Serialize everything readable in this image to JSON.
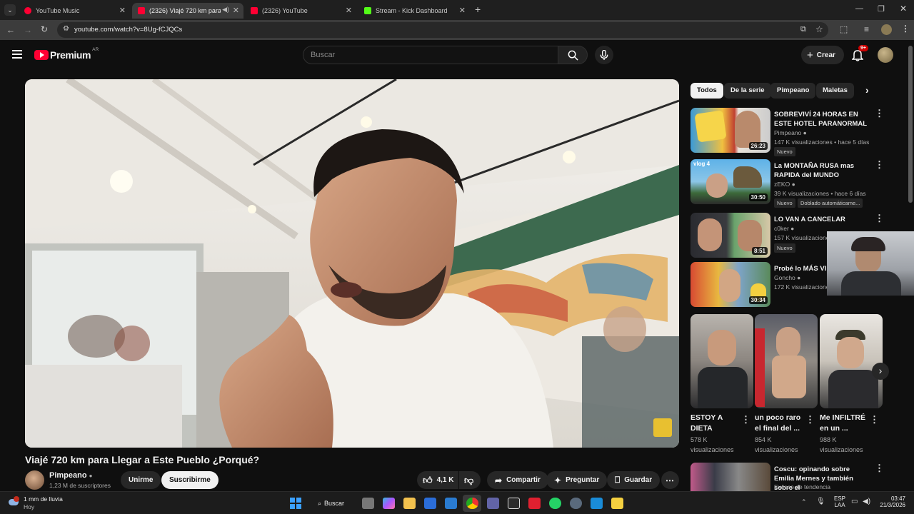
{
  "browser": {
    "tabs": [
      {
        "title": "YouTube Music",
        "active": false
      },
      {
        "title": "(2326) Viajé 720 km para Ll",
        "active": true
      },
      {
        "title": "(2326) YouTube",
        "active": false
      },
      {
        "title": "Stream - Kick Dashboard",
        "active": false
      }
    ],
    "url": "youtube.com/watch?v=8Ug-fCJQCs"
  },
  "header": {
    "logo_text": "Premium",
    "region": "AR",
    "search_placeholder": "Buscar",
    "create_label": "Crear",
    "notif_count": "9+"
  },
  "video": {
    "title": "Viajé 720 km para Llegar a Este Pueblo ¿Porqué?",
    "channel": "Pimpeano",
    "subscribers": "1,23 M de suscriptores",
    "join_label": "Unirme",
    "subscribe_label": "Suscribirme",
    "likes": "4,1 K",
    "share_label": "Compartir",
    "ask_label": "Preguntar",
    "save_label": "Guardar"
  },
  "chips": [
    "Todos",
    "De la serie",
    "Pimpeano",
    "Maletas"
  ],
  "recommendations": [
    {
      "title": "SOBREVIVÍ 24 HORAS EN ESTE HOTEL PARANORMAL",
      "channel": "Pimpeano",
      "meta": "147 K visualizaciones • hace 5 días",
      "badge": "Nuevo",
      "duration": "26:23"
    },
    {
      "title": "La MONTAÑA RUSA mas RAPIDA del MUNDO",
      "channel": "zEKO",
      "meta": "39 K visualizaciones • hace 6 días",
      "badge": "Nuevo",
      "extra": "Doblado automáticame...",
      "duration": "30:50"
    },
    {
      "title": "LO VAN A CANCELAR",
      "channel": "c0ker",
      "meta": "157 K visualizacione",
      "badge": "Nuevo",
      "duration": "8:51"
    },
    {
      "title": "Probé lo MÁS VIR",
      "channel": "Goncho",
      "meta": "172 K visualizacione",
      "duration": "30:34"
    }
  ],
  "shorts": [
    {
      "title": "ESTOY A DIETA",
      "views": "578 K visualizaciones"
    },
    {
      "title": "un poco raro el final del ...",
      "views": "854 K visualizaciones"
    },
    {
      "title": "Me INFILTRÉ en un ...",
      "views": "988 K visualizaciones"
    }
  ],
  "bottom_rec": {
    "title": "Coscu: opinando sobre Emilia Mernes y también sobre el",
    "channel": "Exceso de tendencia"
  },
  "taskbar": {
    "weather": "1 mm de lluvia",
    "weather_sub": "Hoy",
    "search_label": "Buscar",
    "lang": "ESP",
    "lang_sub": "LAA",
    "time": "03:47",
    "date": "21/3/2026"
  },
  "colors": {
    "yt_red": "#ff0033",
    "kick_green": "#53fc18",
    "bg": "#0f0f0f"
  }
}
